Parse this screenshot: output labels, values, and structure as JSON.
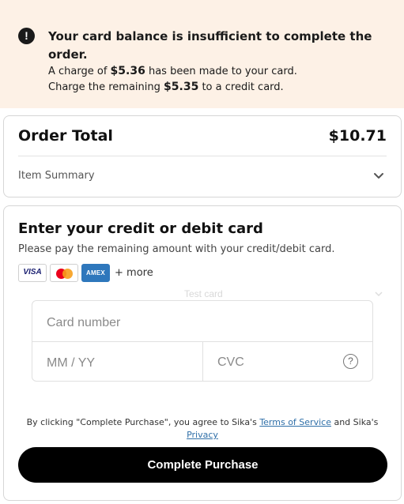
{
  "alert": {
    "icon": "exclamation-icon",
    "title": "Your card balance is insufficient to complete the order.",
    "line1_prefix": "A charge of ",
    "line1_amount": "$5.36",
    "line1_suffix": " has been made to your card.",
    "line2_prefix": "Charge the remaining ",
    "line2_amount": "$5.35",
    "line2_suffix": " to a credit card."
  },
  "order": {
    "title": "Order Total",
    "amount": "$10.71",
    "item_summary": "Item Summary",
    "toggle_icon": "chevron-down-icon"
  },
  "payment": {
    "title": "Enter your credit or debit card",
    "subtitle": "Please pay the remaining amount with your credit/debit card.",
    "brands": [
      "VISA",
      "Mastercard",
      "AMEX"
    ],
    "more": "+ more",
    "test_card": "Test card",
    "fields": {
      "card_number_placeholder": "Card number",
      "expiry_placeholder": "MM / YY",
      "cvc_placeholder": "CVC",
      "help_icon": "question-circle-icon"
    }
  },
  "legal": {
    "prefix": "By clicking \"Complete Purchase\", you agree to Sika's ",
    "terms_link": "Terms of Service",
    "middle": " and Sika's ",
    "privacy_link": "Privacy"
  },
  "cta": {
    "label": "Complete Purchase"
  },
  "colors": {
    "alert_bg": "#fdf1e6",
    "primary": "#000000",
    "link": "#2f6fa8",
    "amex": "#2e77bc"
  }
}
